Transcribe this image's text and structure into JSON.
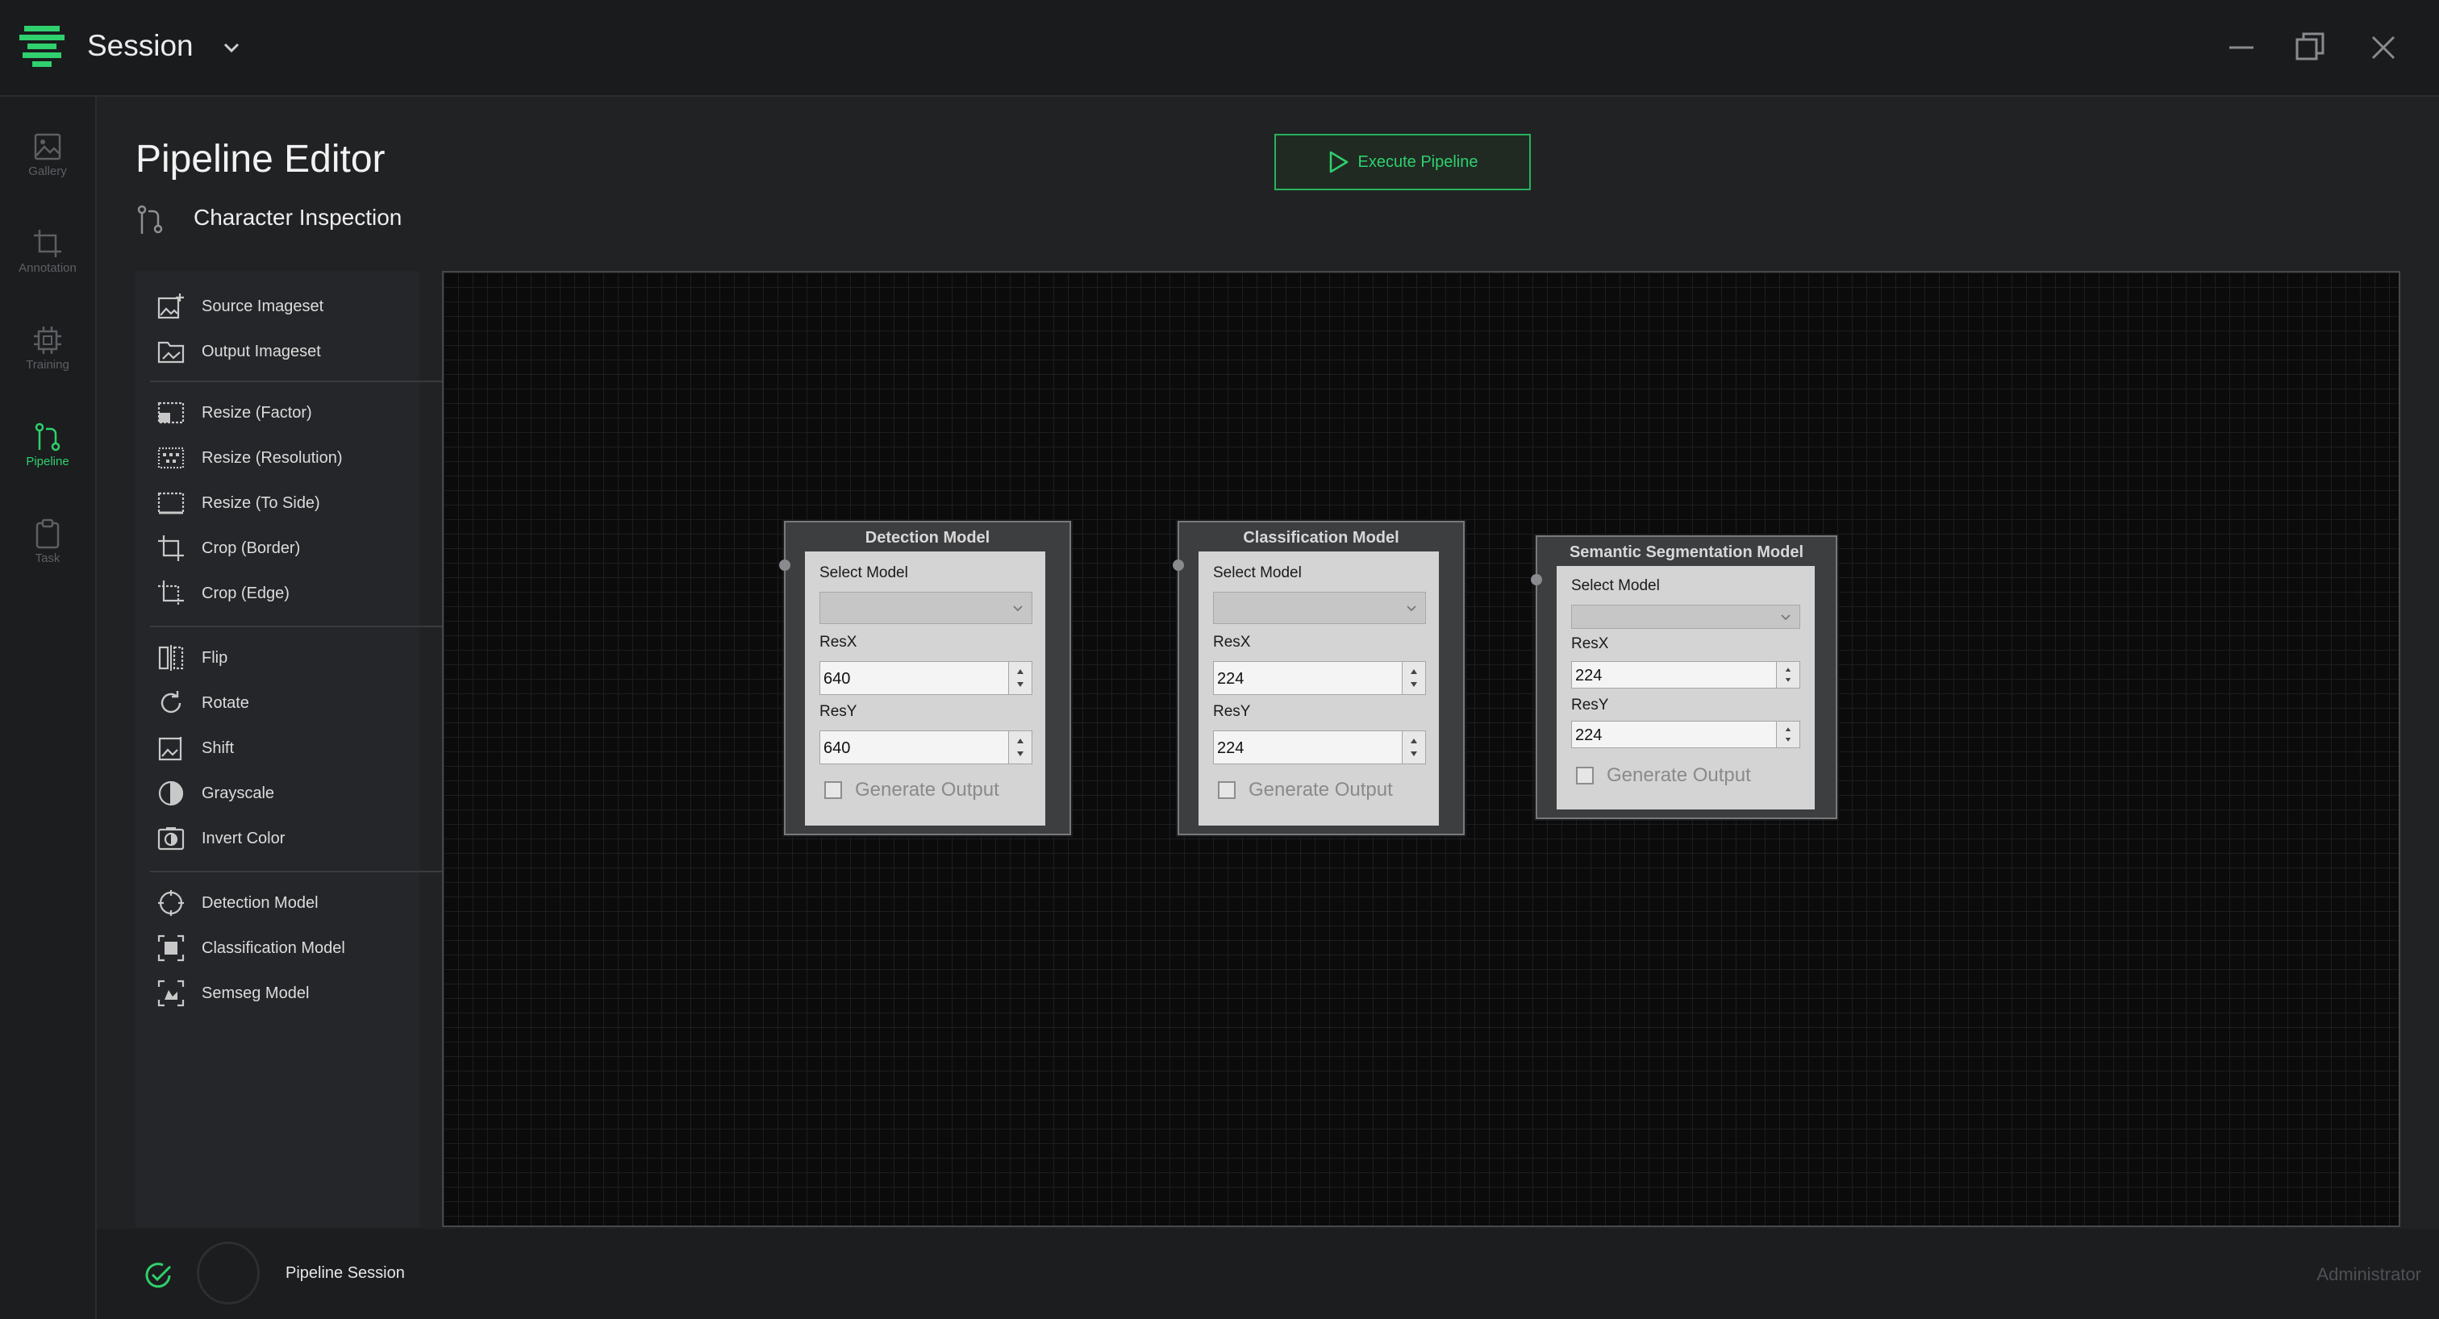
{
  "titlebar": {
    "session_label": "Session"
  },
  "nav": [
    {
      "label": "Gallery",
      "icon": "image-icon",
      "active": false
    },
    {
      "label": "Annotation",
      "icon": "crop-icon",
      "active": false
    },
    {
      "label": "Training",
      "icon": "chip-icon",
      "active": false
    },
    {
      "label": "Pipeline",
      "icon": "pipeline-icon",
      "active": true
    },
    {
      "label": "Task",
      "icon": "clipboard-icon",
      "active": false
    }
  ],
  "header": {
    "title": "Pipeline Editor",
    "pipeline_name": "Character Inspection",
    "execute_label": "Execute Pipeline"
  },
  "palette": {
    "groups": [
      [
        {
          "label": "Source Imageset",
          "icon": "image-add-icon"
        },
        {
          "label": "Output Imageset",
          "icon": "folder-image-icon"
        }
      ],
      [
        {
          "label": "Resize (Factor)",
          "icon": "resize-factor-icon"
        },
        {
          "label": "Resize (Resolution)",
          "icon": "resize-resolution-icon"
        },
        {
          "label": "Resize (To Side)",
          "icon": "resize-side-icon"
        },
        {
          "label": "Crop (Border)",
          "icon": "crop-border-icon"
        },
        {
          "label": "Crop (Edge)",
          "icon": "crop-edge-icon"
        }
      ],
      [
        {
          "label": "Flip",
          "icon": "flip-icon"
        },
        {
          "label": "Rotate",
          "icon": "rotate-icon"
        },
        {
          "label": "Shift",
          "icon": "shift-icon"
        },
        {
          "label": "Grayscale",
          "icon": "grayscale-icon"
        },
        {
          "label": "Invert Color",
          "icon": "invert-color-icon"
        }
      ],
      [
        {
          "label": "Detection Model",
          "icon": "detection-icon"
        },
        {
          "label": "Classification Model",
          "icon": "classification-icon"
        },
        {
          "label": "Semseg Model",
          "icon": "semseg-icon"
        }
      ]
    ]
  },
  "nodes": [
    {
      "title": "Detection Model",
      "select_label": "Select Model",
      "select_value": "",
      "resx_label": "ResX",
      "resx": "640",
      "resy_label": "ResY",
      "resy": "640",
      "generate_label": "Generate Output",
      "generate_checked": false
    },
    {
      "title": "Classification Model",
      "select_label": "Select Model",
      "select_value": "",
      "resx_label": "ResX",
      "resx": "224",
      "resy_label": "ResY",
      "resy": "224",
      "generate_label": "Generate Output",
      "generate_checked": false
    },
    {
      "title": "Semantic Segmentation Model",
      "select_label": "Select Model",
      "select_value": "",
      "resx_label": "ResX",
      "resx": "224",
      "resy_label": "ResY",
      "resy": "224",
      "generate_label": "Generate Output",
      "generate_checked": false
    }
  ],
  "status": {
    "session_name": "Pipeline Session",
    "user": "Administrator"
  },
  "colors": {
    "accent": "#2fd06d",
    "background": "#212224",
    "canvas": "#0b0b0c"
  }
}
